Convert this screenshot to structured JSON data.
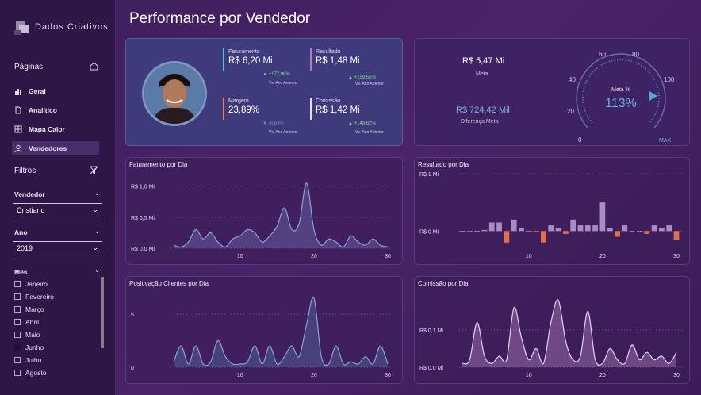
{
  "app": {
    "logo_text": "Dados Criativos",
    "page_title": "Performance por Vendedor"
  },
  "sidebar": {
    "pages_heading": "Páginas",
    "nav": [
      {
        "label": "Geral",
        "icon": "bar-chart-icon"
      },
      {
        "label": "Analítico",
        "icon": "document-icon"
      },
      {
        "label": "Mapa Calor",
        "icon": "grid-icon"
      },
      {
        "label": "Vendedores",
        "icon": "user-icon",
        "active": true
      }
    ],
    "filters_heading": "Filtros",
    "vendedor_label": "Vendedor",
    "vendedor_value": "Cristiano",
    "ano_label": "Ano",
    "ano_value": "2019",
    "mes_label": "Mês",
    "months": [
      "Janeiro",
      "Fevereiro",
      "Março",
      "Abril",
      "Maio",
      "Junho",
      "Julho",
      "Agosto"
    ],
    "selected_month": "Junho"
  },
  "kpis": {
    "faturamento": {
      "label": "Faturamento",
      "value": "R$ 6,20 Mi",
      "delta": "+177,96%",
      "sub": "Vs. Ano Anterior",
      "color": "#5bc0de"
    },
    "resultado": {
      "label": "Resultado",
      "value": "R$ 1,48 Mi",
      "delta": "+159,55%",
      "sub": "Vs. Ano Anterior",
      "color": "#b07cc6"
    },
    "margem": {
      "label": "Margem",
      "value": "23,89%",
      "delta": "-6,63%",
      "sub": "Vs. Ano Anterior",
      "color": "#e8845a"
    },
    "comissao": {
      "label": "Comissão",
      "value": "R$ 1,42 Mi",
      "delta": "+148,62%",
      "sub": "Vs. Ano Anterior",
      "color": "#e0e0f0"
    }
  },
  "meta": {
    "meta_value": "R$ 5,47 Mi",
    "meta_label": "Meta",
    "diff_value": "R$ 724,42 Mil",
    "diff_label": "Diferença Meta",
    "gauge_label": "Meta %",
    "gauge_value": "113%",
    "gauge_fraction": 1.13,
    "ticks": [
      "0",
      "20",
      "40",
      "60",
      "80",
      "100"
    ],
    "max_label": "MAX"
  },
  "charts": {
    "faturamento_dia": {
      "title": "Faturamento por Dia",
      "y_ticks": [
        "R$ 1,0 Mi",
        "R$ 0,5 Mi",
        "R$ 0,0 Mi"
      ],
      "x_ticks": [
        "10",
        "20",
        "30"
      ]
    },
    "resultado_dia": {
      "title": "Resultado por Dia",
      "y_ticks": [
        "R$ 1 Mi",
        "R$ 0 Mi"
      ],
      "x_ticks": [
        "10",
        "20",
        "30"
      ]
    },
    "positivacao_dia": {
      "title": "Positivação Clientes por Dia",
      "y_ticks": [
        "5",
        "0"
      ],
      "x_ticks": [
        "10",
        "20",
        "30"
      ]
    },
    "comissao_dia": {
      "title": "Comissão por Dia",
      "y_ticks": [
        "R$ 0,1 Mi",
        "R$ 0,0 Mi"
      ],
      "x_ticks": [
        "10",
        "20",
        "30"
      ]
    }
  },
  "chart_data": [
    {
      "type": "area",
      "title": "Faturamento por Dia",
      "x": [
        1,
        2,
        3,
        4,
        5,
        6,
        7,
        8,
        9,
        10,
        11,
        12,
        13,
        14,
        15,
        16,
        17,
        18,
        19,
        20,
        21,
        22,
        23,
        24,
        25,
        26,
        27,
        28,
        29,
        30
      ],
      "y": [
        0.05,
        0.02,
        0.1,
        0.3,
        0.15,
        0.25,
        0.1,
        0.02,
        0.15,
        0.2,
        0.3,
        0.25,
        0.1,
        0.2,
        0.35,
        0.65,
        0.3,
        0.4,
        1.05,
        0.3,
        0.05,
        0.15,
        0.1,
        0.02,
        0.2,
        0.1,
        0.05,
        0.15,
        0.05,
        0.02
      ],
      "ylim": [
        0,
        1.2
      ],
      "color": "#6b6ba8"
    },
    {
      "type": "bar",
      "title": "Resultado por Dia",
      "x": [
        1,
        2,
        3,
        4,
        5,
        6,
        7,
        8,
        9,
        10,
        11,
        12,
        13,
        14,
        15,
        16,
        17,
        18,
        19,
        20,
        21,
        22,
        23,
        24,
        25,
        26,
        27,
        28,
        29,
        30
      ],
      "y": [
        0,
        0,
        0,
        0.02,
        0.15,
        0.15,
        -0.2,
        0.2,
        0.05,
        0,
        -0.02,
        -0.2,
        0.1,
        0.05,
        -0.05,
        0.2,
        0.1,
        0.1,
        0.1,
        0.5,
        0.05,
        -0.1,
        0.1,
        0,
        0,
        -0.05,
        0.1,
        0.05,
        0.1,
        -0.15
      ],
      "ylim": [
        -0.3,
        1.0
      ],
      "pos_color": "#a98cc4",
      "neg_color": "#e0704e"
    },
    {
      "type": "area",
      "title": "Positivação Clientes por Dia",
      "x": [
        1,
        2,
        3,
        4,
        5,
        6,
        7,
        8,
        9,
        10,
        11,
        12,
        13,
        14,
        15,
        16,
        17,
        18,
        19,
        20,
        21,
        22,
        23,
        24,
        25,
        26,
        27,
        28,
        29,
        30
      ],
      "y": [
        0.5,
        2,
        0.3,
        2,
        0.3,
        0.5,
        2.5,
        1,
        0.3,
        0.3,
        0.5,
        2,
        0.3,
        2,
        0.3,
        1,
        2,
        1,
        4,
        6.5,
        1,
        0.3,
        2,
        0.3,
        0.5,
        0.3,
        1,
        0.3,
        2,
        0.3
      ],
      "ylim": [
        0,
        7
      ],
      "color": "#4f6aa0"
    },
    {
      "type": "area",
      "title": "Comissão por Dia",
      "x": [
        1,
        2,
        3,
        4,
        5,
        6,
        7,
        8,
        9,
        10,
        11,
        12,
        13,
        14,
        15,
        16,
        17,
        18,
        19,
        20,
        21,
        22,
        23,
        24,
        25,
        26,
        27,
        28,
        29,
        30
      ],
      "y": [
        0.01,
        0.02,
        0.12,
        0.03,
        0.01,
        0.03,
        0.02,
        0.16,
        0.08,
        0.02,
        0.05,
        0.01,
        0.12,
        0.18,
        0.07,
        0.02,
        0.03,
        0.15,
        0.02,
        0.01,
        0.05,
        0.02,
        0.01,
        0.06,
        0.02,
        0.04,
        0.02,
        0.03,
        0.01,
        0.04
      ],
      "ylim": [
        0,
        0.2
      ],
      "color": "#a87cb8"
    }
  ]
}
